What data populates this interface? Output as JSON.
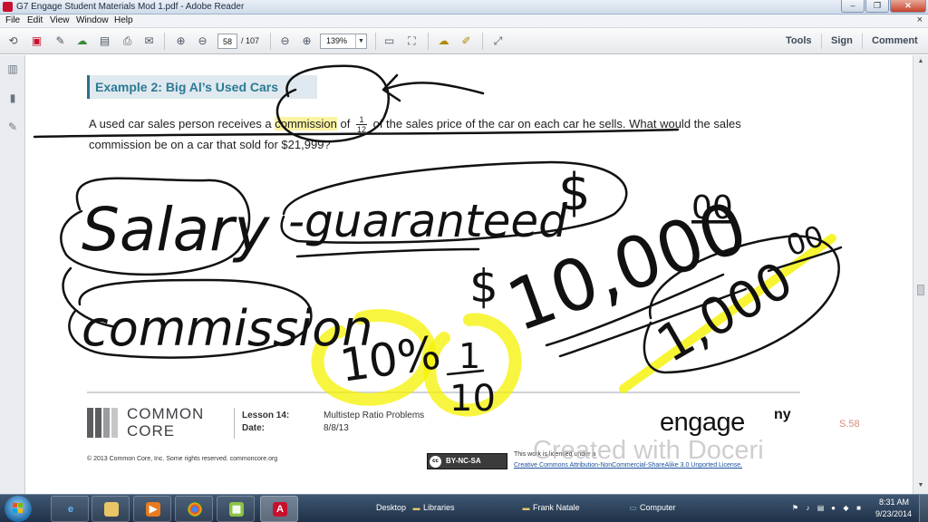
{
  "window": {
    "title": "G7 Engage Student Materials Mod 1.pdf - Adobe Reader",
    "minimize": "–",
    "restore": "❐",
    "close": "✕"
  },
  "menu": {
    "items": [
      "File",
      "Edit",
      "View",
      "Window",
      "Help"
    ],
    "close_glyph": "×"
  },
  "toolbar": {
    "page_current": "58",
    "page_total": "/ 107",
    "zoom": "139%",
    "tools_label": "Tools",
    "sign_label": "Sign",
    "comment_label": "Comment"
  },
  "document": {
    "example_title": "Example 2:  Big Al’s Used Cars",
    "problem_part1": "A used car sales person receives a",
    "problem_highlight": "commission",
    "problem_part2": "of",
    "fraction_num": "1",
    "fraction_den": "12",
    "problem_part3": "of the sales price of the car on each car he sells. What would the sales commission be on a car that sold for $21,999?",
    "footer": {
      "org_line1": "COMMON",
      "org_line2": "CORE",
      "lesson_label": "Lesson 14:",
      "date_label": "Date:",
      "lesson_value": "Multistep Ratio Problems",
      "date_value": "8/8/13",
      "brand": "engage",
      "brand_suffix": "ny",
      "page_number": "S.58",
      "copyright": "© 2013 Common Core, Inc. Some rights reserved. commoncore.org",
      "cc_badge": "BY-NC-SA",
      "license_line1": "This work is licensed under a",
      "license_line2": "Creative Commons Attribution-NonCommercial-ShareAlike 3.0 Unported License."
    },
    "handwriting": {
      "word1": "Salary",
      "word2": "-guaranteed",
      "dollar1": "$",
      "word3": "commission",
      "dollar2": "$",
      "amount": "10,000",
      "amount_cents": "00",
      "percent": "10%",
      "frac_num": "1",
      "frac_den": "10",
      "small_amount": "1,000",
      "small_cents": "00"
    },
    "watermark": "Created with Doceri"
  },
  "taskbar": {
    "desktop_label": "Desktop",
    "libraries_label": "Libraries",
    "user_label": "Frank Natale",
    "computer_label": "Computer",
    "time": "8:31 AM",
    "date": "9/23/2014"
  },
  "colors": {
    "accent_title": "#2c7a93",
    "highlighter": "#f5f200",
    "ink": "#111111"
  }
}
